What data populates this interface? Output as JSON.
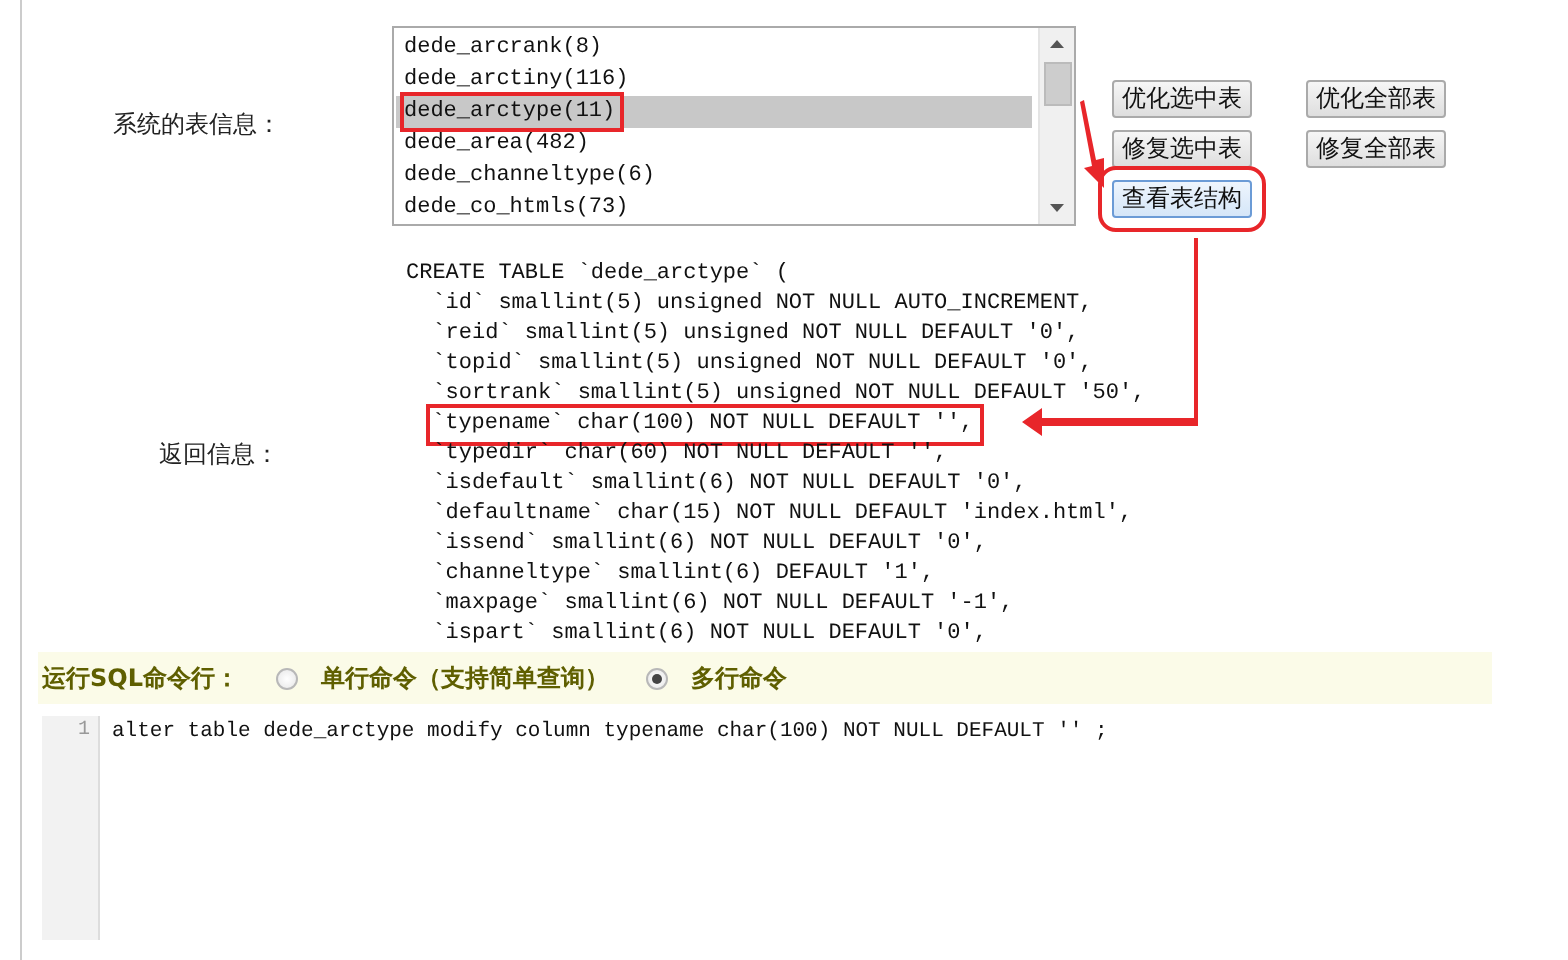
{
  "table_info": {
    "label": "系统的表信息：",
    "tables": [
      {
        "name": "dede_arcrank(8)",
        "selected": false,
        "highlighted": false
      },
      {
        "name": "dede_arctiny(116)",
        "selected": false,
        "highlighted": false
      },
      {
        "name": "dede_arctype(11)",
        "selected": true,
        "highlighted": true
      },
      {
        "name": "dede_area(482)",
        "selected": false,
        "highlighted": false
      },
      {
        "name": "dede_channeltype(6)",
        "selected": false,
        "highlighted": false
      },
      {
        "name": "dede_co_htmls(73)",
        "selected": false,
        "highlighted": false
      }
    ],
    "buttons": [
      {
        "label": "优化选中表",
        "focused": false,
        "highlighted": false
      },
      {
        "label": "优化全部表",
        "focused": false,
        "highlighted": false
      },
      {
        "label": "修复选中表",
        "focused": false,
        "highlighted": false
      },
      {
        "label": "修复全部表",
        "focused": false,
        "highlighted": false
      },
      {
        "label": "查看表结构",
        "focused": true,
        "highlighted": true
      }
    ]
  },
  "return_info": {
    "label": "返回信息：",
    "lines": [
      {
        "text": "CREATE TABLE `dede_arctype` (",
        "highlighted": false
      },
      {
        "text": "  `id` smallint(5) unsigned NOT NULL AUTO_INCREMENT,",
        "highlighted": false
      },
      {
        "text": "  `reid` smallint(5) unsigned NOT NULL DEFAULT '0',",
        "highlighted": false
      },
      {
        "text": "  `topid` smallint(5) unsigned NOT NULL DEFAULT '0',",
        "highlighted": false
      },
      {
        "text": "  `sortrank` smallint(5) unsigned NOT NULL DEFAULT '50',",
        "highlighted": false
      },
      {
        "text": "  `typename` char(100) NOT NULL DEFAULT '',",
        "highlighted": true
      },
      {
        "text": "  `typedir` char(60) NOT NULL DEFAULT '',",
        "highlighted": false
      },
      {
        "text": "  `isdefault` smallint(6) NOT NULL DEFAULT '0',",
        "highlighted": false
      },
      {
        "text": "  `defaultname` char(15) NOT NULL DEFAULT 'index.html',",
        "highlighted": false
      },
      {
        "text": "  `issend` smallint(6) NOT NULL DEFAULT '0',",
        "highlighted": false
      },
      {
        "text": "  `channeltype` smallint(6) DEFAULT '1',",
        "highlighted": false
      },
      {
        "text": "  `maxpage` smallint(6) NOT NULL DEFAULT '-1',",
        "highlighted": false
      },
      {
        "text": "  `ispart` smallint(6) NOT NULL DEFAULT '0',",
        "highlighted": false
      }
    ]
  },
  "sql": {
    "label": "运行SQL命令行：",
    "modes": [
      {
        "label": "单行命令（支持简单查询）",
        "selected": false
      },
      {
        "label": "多行命令",
        "selected": true
      }
    ],
    "editor_lines": [
      {
        "number": "1",
        "text": "alter table dede_arctype modify column typename char(100) NOT NULL DEFAULT '' ;"
      }
    ]
  }
}
